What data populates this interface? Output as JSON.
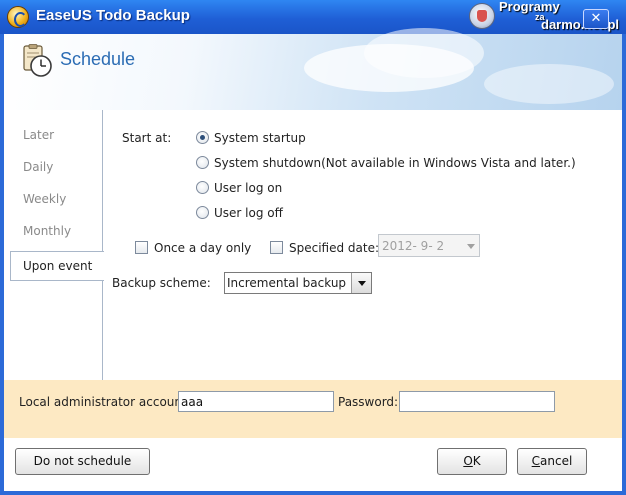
{
  "window": {
    "title": "EaseUS Todo Backup",
    "watermark": {
      "line1": "Programy",
      "line2": "za",
      "line3": "darmo.net.pl"
    },
    "close_label": "✕"
  },
  "header": {
    "title": "Schedule",
    "icon": "clock-icon"
  },
  "sidebar": {
    "items": [
      "Later",
      "Daily",
      "Weekly",
      "Monthly"
    ],
    "active": "Upon event"
  },
  "schedule": {
    "start_at_label": "Start at:",
    "options": [
      {
        "label": "System startup",
        "selected": true
      },
      {
        "label": "System shutdown(Not available in Windows Vista and later.)",
        "selected": false
      },
      {
        "label": "User log on",
        "selected": false
      },
      {
        "label": "User log off",
        "selected": false
      }
    ],
    "once_a_day_label": "Once a day only",
    "once_a_day_checked": false,
    "specified_date_label": "Specified date:",
    "specified_date_checked": false,
    "specified_date_value": "2012- 9- 2",
    "backup_scheme_label": "Backup scheme:",
    "backup_scheme_value": "Incremental backup"
  },
  "account": {
    "admin_label": "Local administrator account:",
    "admin_value": "aaa",
    "password_label": "Password:",
    "password_value": ""
  },
  "buttons": {
    "do_not_schedule": "Do not schedule",
    "ok_underline": "O",
    "ok_rest": "K",
    "cancel_underline": "C",
    "cancel_rest": "ancel"
  },
  "colors": {
    "accent": "#2b6cb4",
    "title_bar": "#1f5fd6",
    "account_band": "#fde9c3"
  }
}
